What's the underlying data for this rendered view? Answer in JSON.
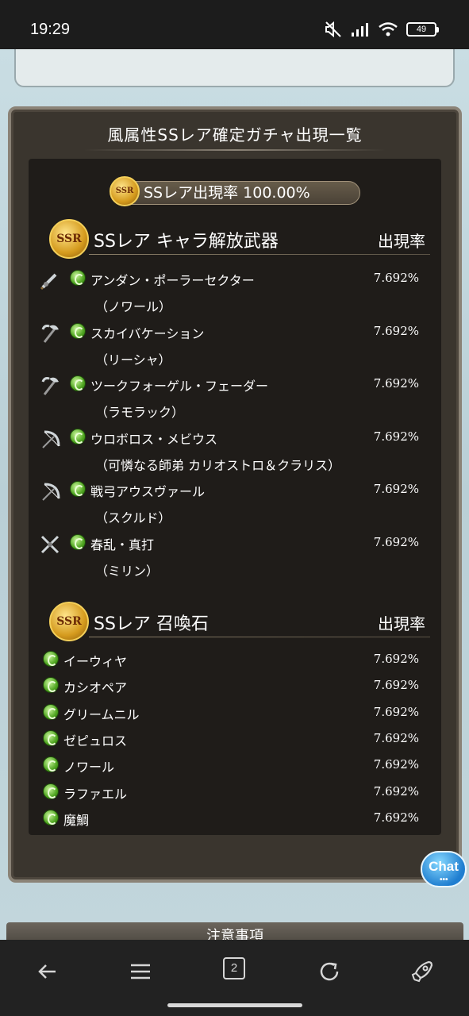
{
  "status_bar": {
    "time": "19:29",
    "battery": "49"
  },
  "panel": {
    "title": "風属性SSレア確定ガチャ出現一覧",
    "ssr_rate_label": "SSレア出現率 100.00%",
    "badge_text": "SSR"
  },
  "weapons_section": {
    "title": "SSレア キャラ解放武器",
    "rate_header": "出現率",
    "items": [
      {
        "name": "アンダン・ポーラーセクター",
        "sub": "（ノワール）",
        "rate": "7.692%",
        "weapon_icon": "sword-icon"
      },
      {
        "name": "スカイバケーション",
        "sub": "（リーシャ）",
        "rate": "7.692%",
        "weapon_icon": "axe-icon"
      },
      {
        "name": "ツークフォーゲル・フェーダー",
        "sub": "（ラモラック）",
        "rate": "7.692%",
        "weapon_icon": "axe-icon"
      },
      {
        "name": "ウロボロス・メビウス",
        "sub": "（可憐なる師弟 カリオストロ＆クラリス）",
        "rate": "7.692%",
        "weapon_icon": "bow-icon"
      },
      {
        "name": "戦弓アウスヴァール",
        "sub": "（スクルド）",
        "rate": "7.692%",
        "weapon_icon": "bow-icon"
      },
      {
        "name": "春乱・真打",
        "sub": "（ミリン）",
        "rate": "7.692%",
        "weapon_icon": "katana-icon"
      }
    ]
  },
  "summons_section": {
    "title": "SSレア 召喚石",
    "rate_header": "出現率",
    "items": [
      {
        "name": "イーウィヤ",
        "rate": "7.692%"
      },
      {
        "name": "カシオペア",
        "rate": "7.692%"
      },
      {
        "name": "グリームニル",
        "rate": "7.692%"
      },
      {
        "name": "ゼピュロス",
        "rate": "7.692%"
      },
      {
        "name": "ノワール",
        "rate": "7.692%"
      },
      {
        "name": "ラファエル",
        "rate": "7.692%"
      },
      {
        "name": "魔鯛",
        "rate": "7.692%"
      }
    ]
  },
  "chat_button": {
    "label": "Chat",
    "dots": "•••"
  },
  "notes": {
    "label": "注意事項"
  },
  "nav": {
    "tab_count": "2"
  },
  "colors": {
    "panel_bg": "#3a352e",
    "wind_green": "#4fa520",
    "gold": "#d59b1e"
  }
}
